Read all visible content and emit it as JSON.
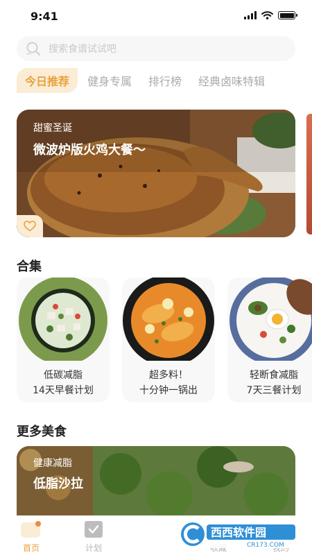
{
  "status_bar": {
    "time": "9:41"
  },
  "search": {
    "placeholder": "搜索食谱试试吧"
  },
  "tabs": [
    {
      "label": "今日推荐",
      "active": true
    },
    {
      "label": "健身专属",
      "active": false
    },
    {
      "label": "排行榜",
      "active": false
    },
    {
      "label": "经典卤味特辑",
      "active": false
    }
  ],
  "hero": {
    "subtitle": "甜蜜圣诞",
    "title": "微波炉版火鸡大餐～"
  },
  "collections": {
    "title": "合集",
    "items": [
      {
        "line1": "低碳减脂",
        "line2": "14天早餐计划"
      },
      {
        "line1": "超多料！",
        "line2": "十分钟一锅出"
      },
      {
        "line1": "轻断食减脂",
        "line2": "7天三餐计划"
      }
    ]
  },
  "more": {
    "title": "更多美食",
    "card": {
      "subtitle": "健康减脂",
      "title": "低脂沙拉"
    }
  },
  "nav": [
    {
      "label": "首页",
      "icon": "home-icon",
      "active": true
    },
    {
      "label": "计划",
      "icon": "plan-check-icon",
      "active": false
    },
    {
      "label": "",
      "icon": "",
      "active": false
    },
    {
      "label": "收藏",
      "icon": "favorites-icon",
      "active": false
    },
    {
      "label": "我的",
      "icon": "profile-icon",
      "active": false
    }
  ],
  "watermark": {
    "text": "西西软件园",
    "url": "CR173.COM"
  },
  "colors": {
    "accent": "#e8a13a",
    "tab_active_bg": "#fbecd6"
  }
}
